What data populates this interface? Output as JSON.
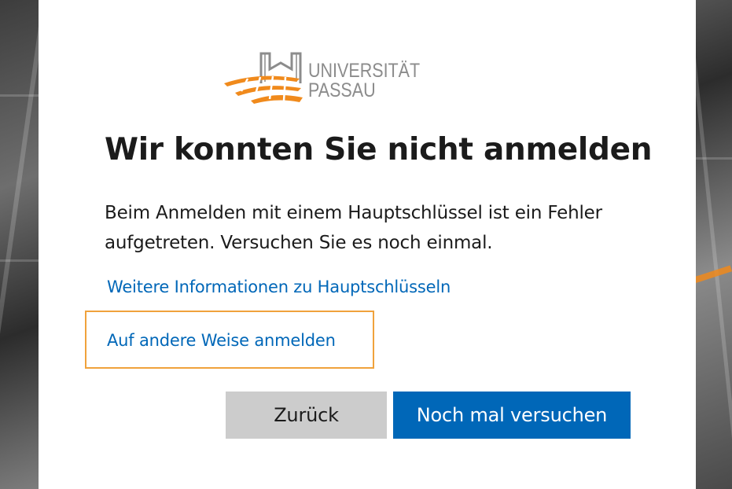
{
  "logo": {
    "line1": "UNIVERSITÄT",
    "line2": "PASSAU",
    "colors": {
      "orange": "#f08a1c",
      "gray": "#8c8c8c"
    }
  },
  "dialog": {
    "title": "Wir konnten Sie nicht anmelden",
    "description": "Beim Anmelden mit einem Hauptschlüssel ist ein Fehler aufgetreten. Versuchen Sie es noch einmal.",
    "links": {
      "more_info": "Weitere Informationen zu Hauptschlüsseln",
      "other_way": "Auf andere Weise anmelden"
    },
    "buttons": {
      "back": "Zurück",
      "retry": "Noch mal versuchen"
    }
  },
  "colors": {
    "link": "#0067b8",
    "primary_button": "#0067b8",
    "secondary_button": "#cccccc",
    "focus_outline": "#f0a23c",
    "text": "#1b1b1b"
  }
}
